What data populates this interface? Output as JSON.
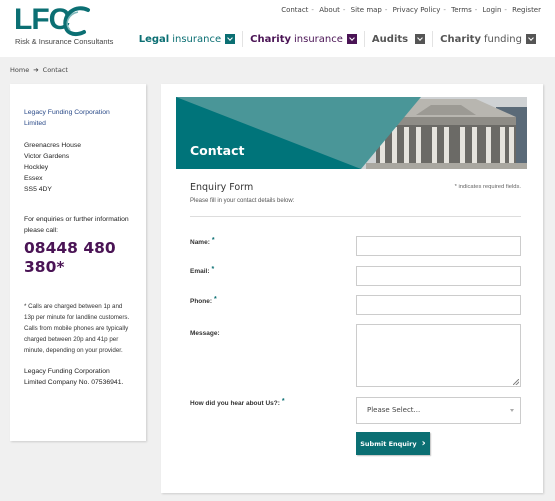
{
  "brand": {
    "letters": "LFC",
    "tagline": "Risk & Insurance Consultants",
    "primary_color": "#0b6f73",
    "accent_purple": "#4a1455"
  },
  "top_links": [
    "Contact",
    "About",
    "Site map",
    "Privacy Policy",
    "Terms",
    "Login",
    "Register"
  ],
  "main_nav": [
    {
      "bold": "Legal",
      "light": "insurance",
      "color": "#0b6f73"
    },
    {
      "bold": "Charity",
      "light": "insurance",
      "color": "#4a1455"
    },
    {
      "bold": "Audits",
      "light": "",
      "color": "#555555"
    },
    {
      "bold": "Charity",
      "light": "funding",
      "color": "#555555"
    }
  ],
  "breadcrumb": {
    "home": "Home",
    "arrow": "➔",
    "current": "Contact"
  },
  "sidebar": {
    "company": "Legacy Funding Corporation Limited",
    "address": [
      "Greenacres House",
      "Victor Gardens",
      "Hockley",
      "Essex",
      "SS5 4DY"
    ],
    "enquiry_text": "For enquiries or further information please call:",
    "phone": "08448 480 380*",
    "call_note": "* Calls are charged between 1p and 13p per minute for landline customers. Calls from mobile phones are typically charged between 20p and 41p per minute, depending on your provider.",
    "registration": "Legacy Funding Corporation Limited Company No. 07536941."
  },
  "hero": {
    "title": "Contact"
  },
  "form": {
    "title": "Enquiry Form",
    "subtitle": "Please fill in your contact details below:",
    "required_note": "* indicates required fields.",
    "required_marker": "*",
    "fields": {
      "name": {
        "label": "Name:",
        "value": ""
      },
      "email": {
        "label": "Email:",
        "value": ""
      },
      "phone": {
        "label": "Phone:",
        "value": ""
      },
      "message": {
        "label": "Message:",
        "value": ""
      },
      "source": {
        "label": "How did you hear about Us?:",
        "selected": "Please Select..."
      }
    },
    "submit_label": "Submit Enquiry",
    "submit_icon": "›"
  }
}
